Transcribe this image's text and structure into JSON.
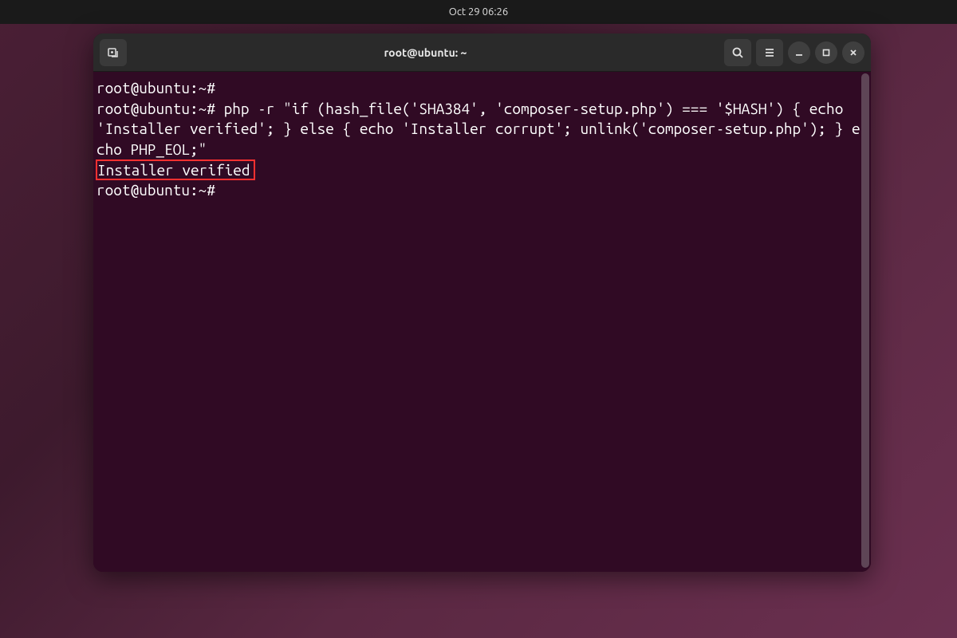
{
  "topbar": {
    "datetime": "Oct 29  06:26"
  },
  "window": {
    "title": "root@ubuntu: ~"
  },
  "terminal": {
    "line1_prompt": "root@ubuntu:~#",
    "line2_prompt": "root@ubuntu:~# ",
    "line2_command": "php -r \"if (hash_file('SHA384', 'composer-setup.php') === '$HASH') { echo 'Installer verified'; } else { echo 'Installer corrupt'; unlink('composer-setup.php'); } echo PHP_EOL;\"",
    "line3_output": "Installer verified",
    "line4_prompt": "root@ubuntu:~#"
  },
  "icons": {
    "newtab": "new-tab-icon",
    "search": "search-icon",
    "menu": "hamburger-menu-icon",
    "minimize": "minimize-icon",
    "maximize": "maximize-icon",
    "close": "close-icon"
  }
}
